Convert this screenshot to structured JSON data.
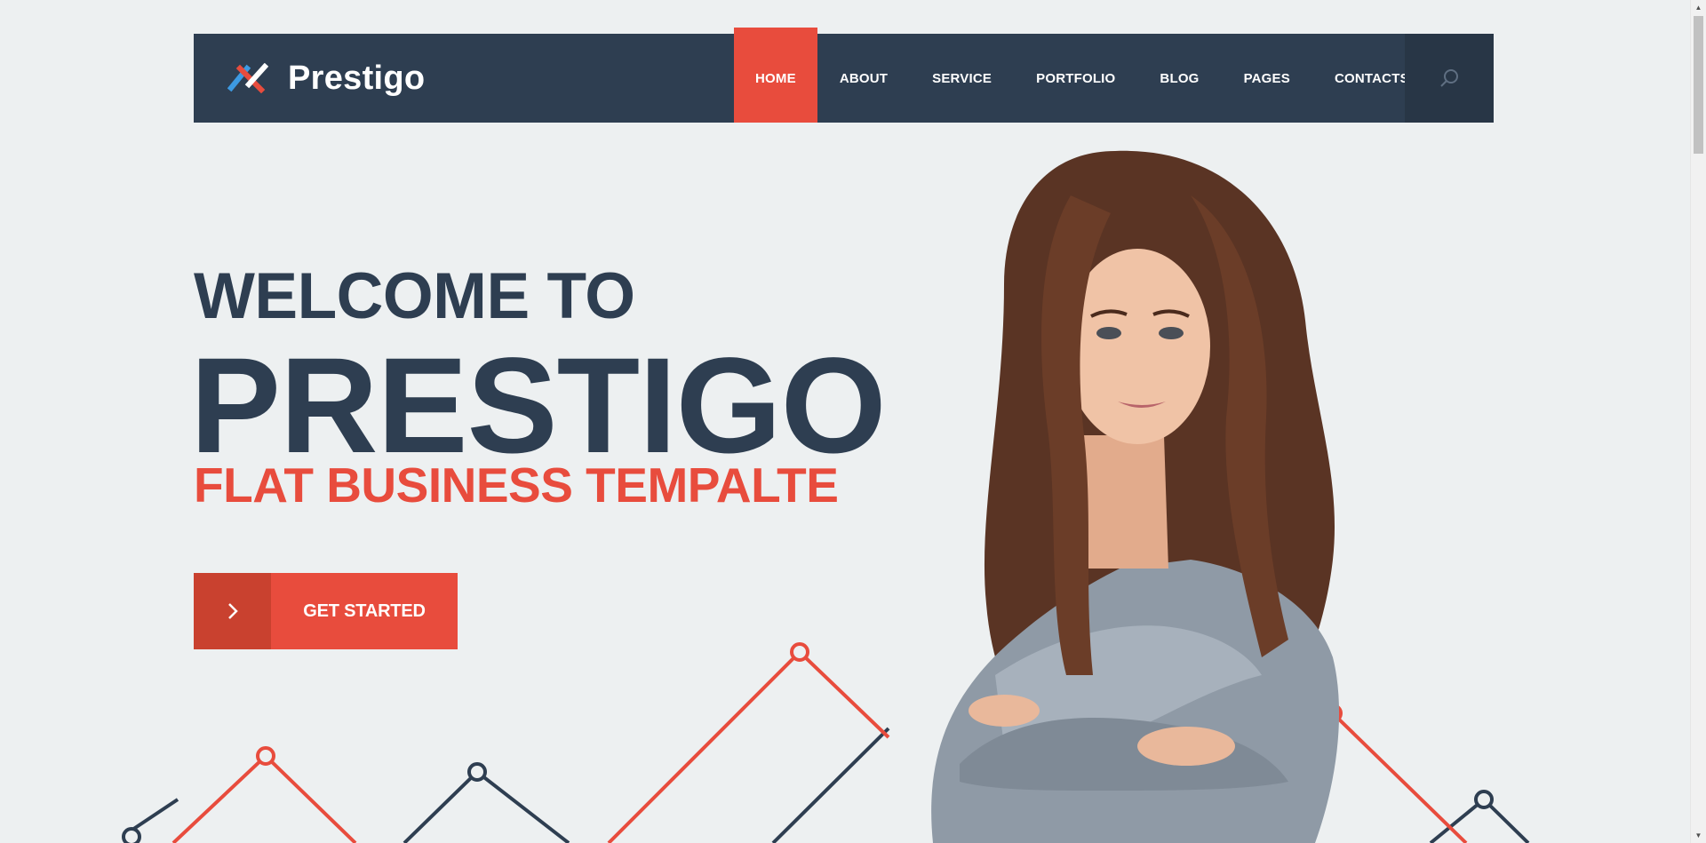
{
  "brand": {
    "name": "Prestigo",
    "logo_icon": "crossed-arrows-logo-icon"
  },
  "nav": {
    "items": [
      {
        "label": "HOME",
        "active": true
      },
      {
        "label": "ABOUT",
        "active": false
      },
      {
        "label": "SERVICE",
        "active": false
      },
      {
        "label": "PORTFOLIO",
        "active": false
      },
      {
        "label": "BLOG",
        "active": false
      },
      {
        "label": "PAGES",
        "active": false
      },
      {
        "label": "CONTACTS",
        "active": false
      }
    ],
    "search_icon": "search-icon"
  },
  "hero": {
    "welcome": "WELCOME TO",
    "brand": "PRESTIGO",
    "tagline": "FLAT BUSINESS TEMPALTE",
    "cta_label": "GET STARTED",
    "cta_icon": "chevron-right-icon"
  },
  "colors": {
    "navy": "#2e3e51",
    "accent_red": "#e84c3d",
    "dark_red": "#c9412f",
    "background": "#edf0f1",
    "logo_blue": "#3d9ae2"
  }
}
